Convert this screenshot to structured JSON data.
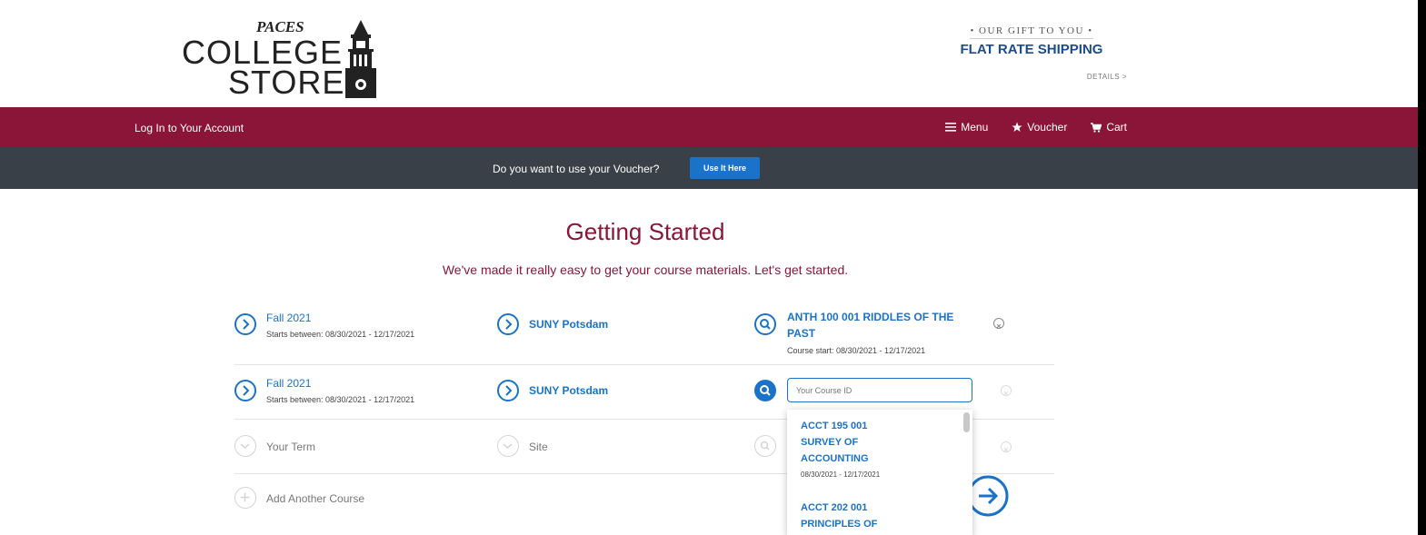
{
  "header": {
    "logo": {
      "line1": "PACES",
      "line2": "COLLEGE",
      "line3": "STORE"
    },
    "promo": {
      "tagline": "• OUR GIFT TO YOU •",
      "headline": "FLAT RATE SHIPPING",
      "details_link": "DETAILS >"
    }
  },
  "navbar": {
    "login": "Log In to Your Account",
    "menu": "Menu",
    "voucher": "Voucher",
    "cart": "Cart"
  },
  "voucher_bar": {
    "question": "Do you want to use your Voucher?",
    "button": "Use It Here"
  },
  "main": {
    "title": "Getting Started",
    "subtitle": "We've made it really easy to get your course materials. Let's get started."
  },
  "rows": [
    {
      "term": "Fall 2021",
      "term_dates": "Starts between: 08/30/2021 - 12/17/2021",
      "site": "SUNY Potsdam",
      "course_line1": "ANTH 100 001 RIDDLES OF THE",
      "course_line2": "PAST",
      "course_dates": "Course start: 08/30/2021 - 12/17/2021"
    },
    {
      "term": "Fall 2021",
      "term_dates": "Starts between: 08/30/2021 - 12/17/2021",
      "site": "SUNY Potsdam",
      "course_placeholder": "Your Course ID"
    },
    {
      "term_placeholder": "Your Term",
      "site_placeholder": "Site"
    }
  ],
  "add_course": "Add Another Course",
  "dropdown": {
    "options": [
      {
        "line1": "ACCT 195 001",
        "line2": "SURVEY OF",
        "line3": "ACCOUNTING",
        "dates": "08/30/2021 - 12/17/2021"
      },
      {
        "line1": "ACCT 202 001",
        "line2": "PRINCIPLES OF"
      }
    ]
  },
  "colors": {
    "brand": "#8a1538",
    "link": "#1a73c8",
    "voucher_bar": "#3a4047"
  }
}
